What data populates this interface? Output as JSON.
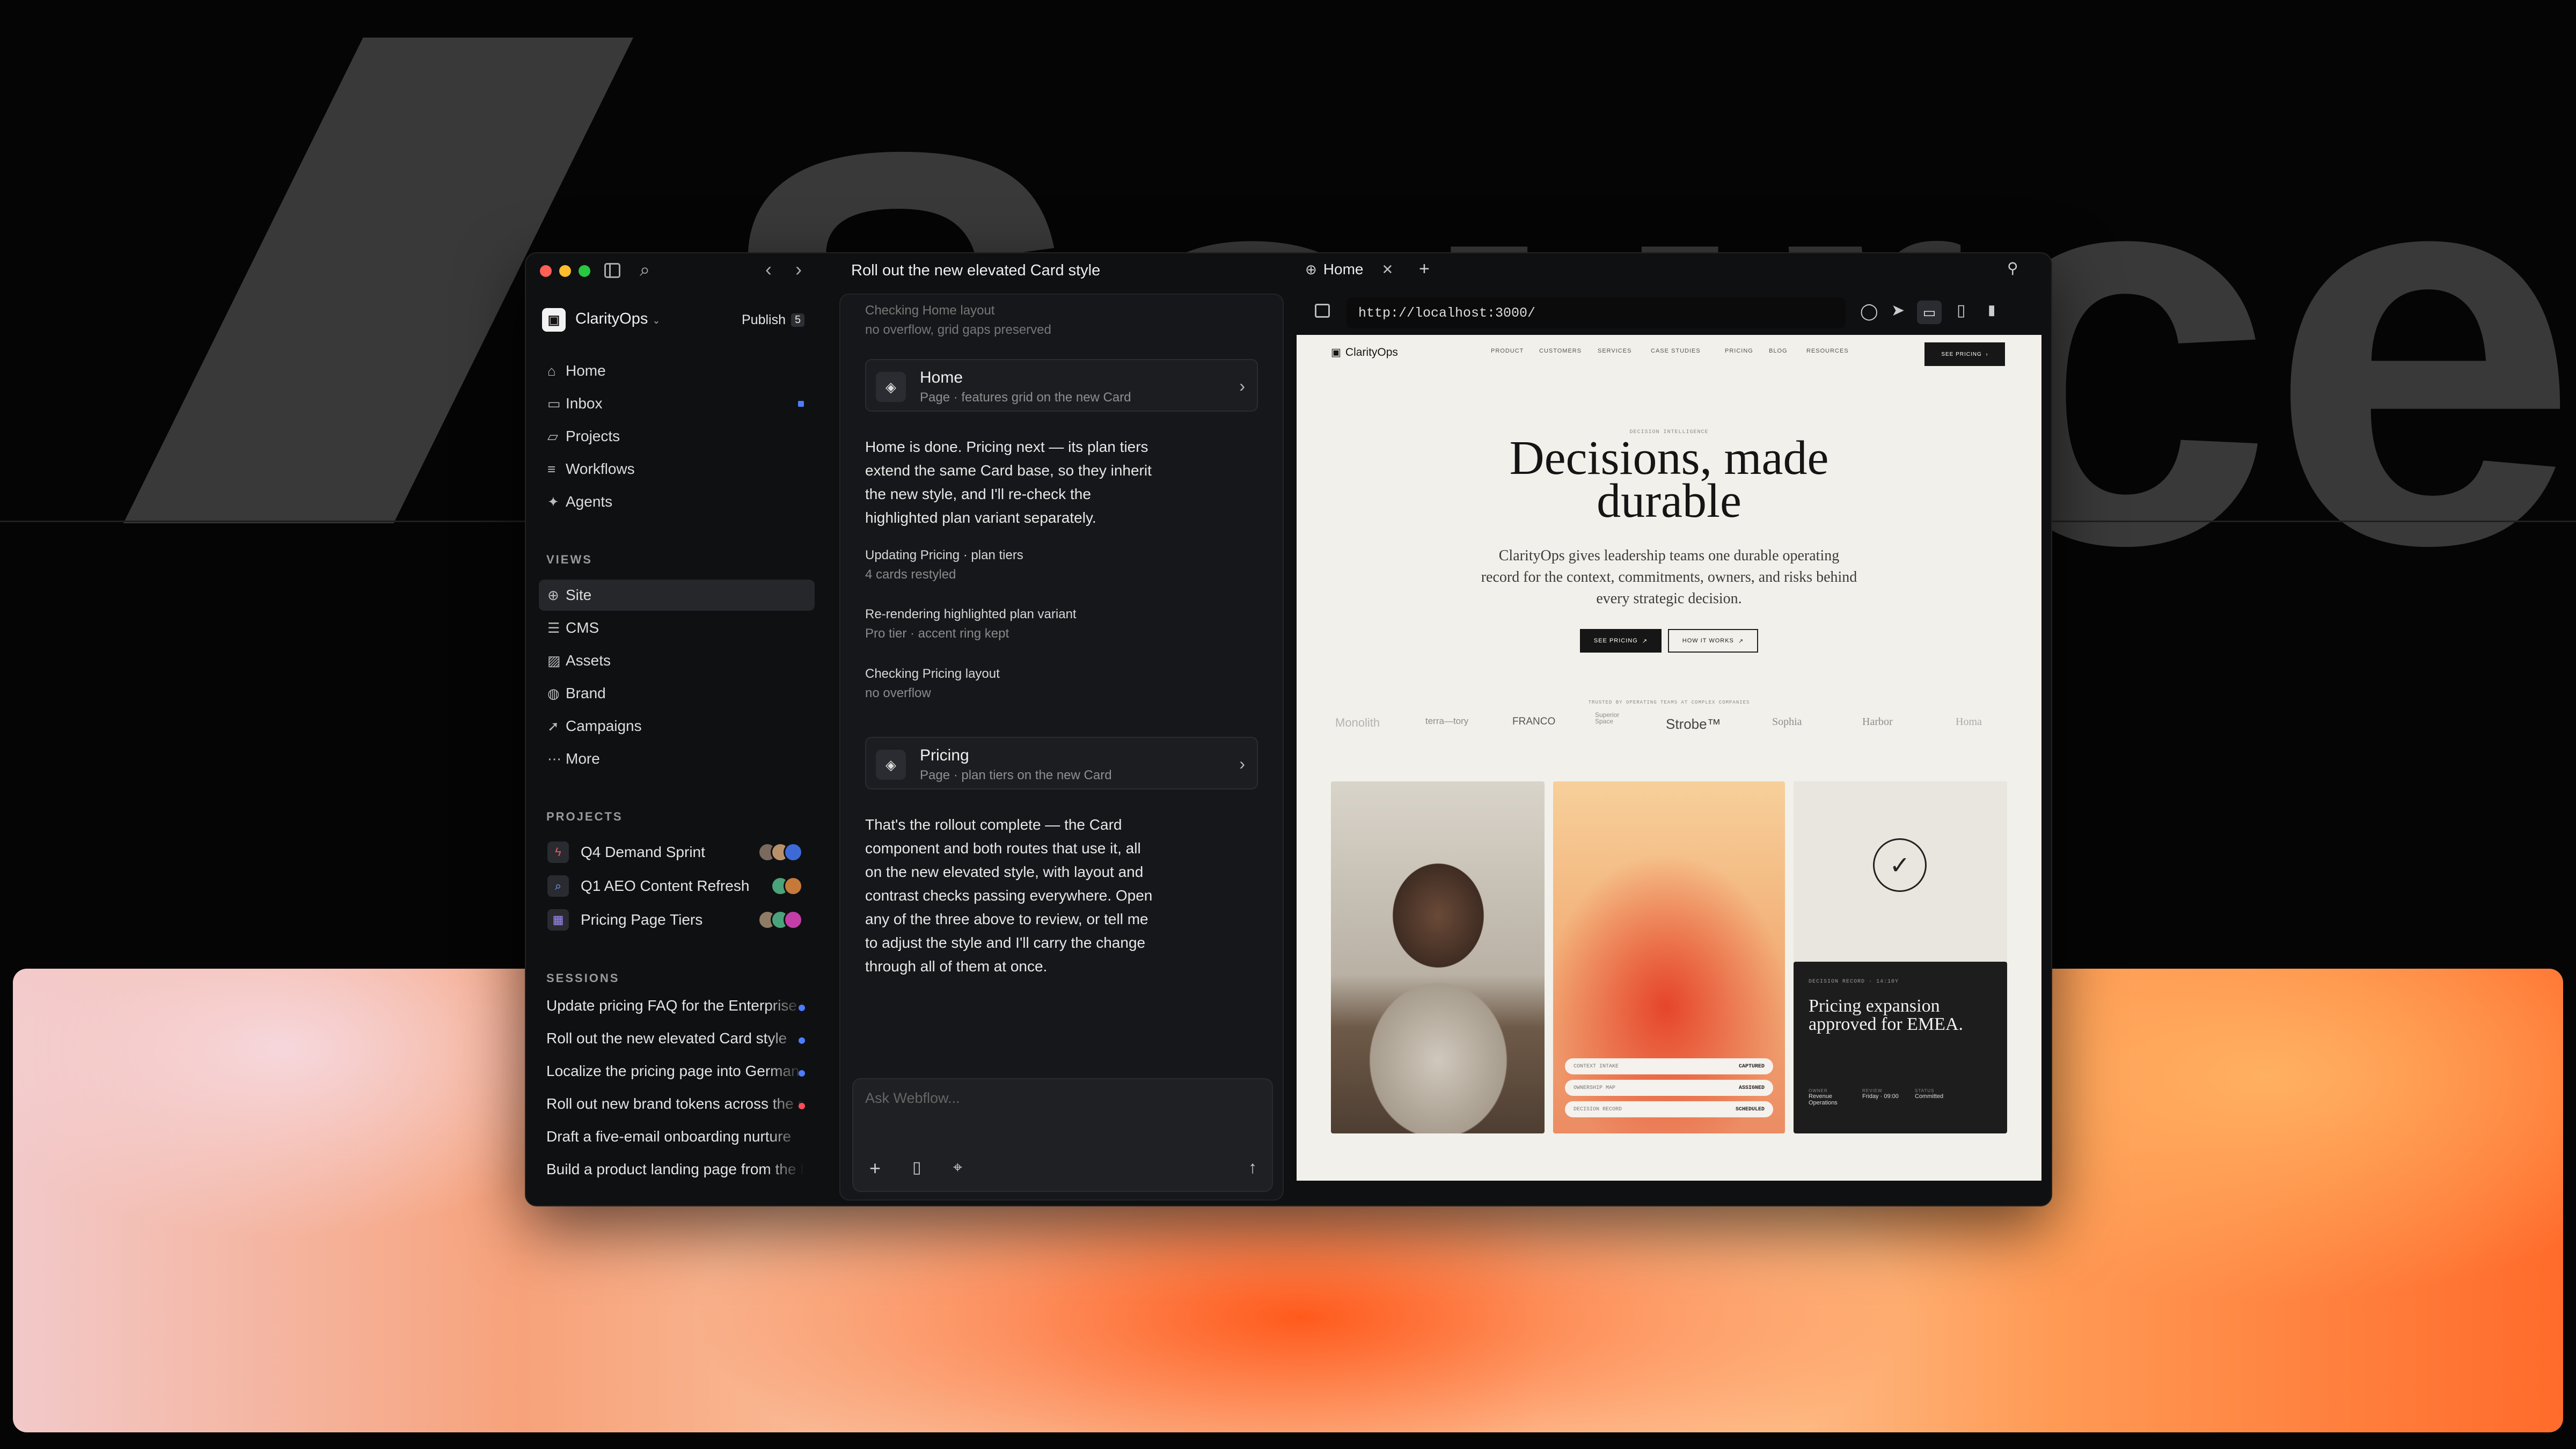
{
  "background": {
    "word": "Source"
  },
  "window": {
    "title": "Roll out the new elevated Card style"
  },
  "sidebar": {
    "workspace": "ClarityOps",
    "publish_label": "Publish",
    "publish_count": "5",
    "nav": [
      {
        "label": "Home",
        "icon": "home-icon"
      },
      {
        "label": "Inbox",
        "icon": "inbox-icon"
      },
      {
        "label": "Projects",
        "icon": "folder-icon"
      },
      {
        "label": "Workflows",
        "icon": "workflow-icon"
      },
      {
        "label": "Agents",
        "icon": "sparkle-icon"
      }
    ],
    "views_header": "VIEWS",
    "views": [
      {
        "label": "Site",
        "icon": "globe-icon"
      },
      {
        "label": "CMS",
        "icon": "database-icon"
      },
      {
        "label": "Assets",
        "icon": "image-icon"
      },
      {
        "label": "Brand",
        "icon": "palette-icon"
      },
      {
        "label": "Campaigns",
        "icon": "rocket-icon"
      },
      {
        "label": "More",
        "icon": "ellipsis-icon"
      }
    ],
    "projects_header": "PROJECTS",
    "projects": [
      {
        "label": "Q4 Demand Sprint",
        "icon": "bolt-icon",
        "color": "#e45b5b"
      },
      {
        "label": "Q1 AEO Content Refresh",
        "icon": "search-icon",
        "color": "#7aa7ff"
      },
      {
        "label": "Pricing Page Tiers",
        "icon": "grid-icon",
        "color": "#a58cff"
      }
    ],
    "sessions_header": "SESSIONS",
    "sessions": [
      {
        "label": "Update pricing FAQ for the Enterprise tier",
        "dot": "#4d7dff"
      },
      {
        "label": "Roll out the new elevated Card style",
        "dot": "#4d7dff"
      },
      {
        "label": "Localize the pricing page into German",
        "dot": "#4d7dff"
      },
      {
        "label": "Roll out new brand tokens across the site",
        "dot": "#ff4d5a"
      },
      {
        "label": "Draft a five-email onboarding nurture",
        "dot": ""
      },
      {
        "label": "Build a product landing page from the brief",
        "dot": ""
      }
    ]
  },
  "chat": {
    "check1_title": "Checking Home layout",
    "check1_sub": "no overflow, grid gaps preserved",
    "card1": {
      "title": "Home",
      "sub": "Page · features grid on the new Card"
    },
    "msg1": "Home is done. Pricing next — its plan tiers extend the same Card base, so they inherit the new style, and I'll re-check the highlighted plan variant separately.",
    "steps": [
      {
        "title": "Updating Pricing · plan tiers",
        "sub": "4 cards restyled"
      },
      {
        "title": "Re-rendering highlighted plan variant",
        "sub": "Pro tier · accent ring kept"
      },
      {
        "title": "Checking Pricing layout",
        "sub": "no overflow"
      }
    ],
    "card2": {
      "title": "Pricing",
      "sub": "Page · plan tiers on the new Card"
    },
    "msg2": "That's the rollout complete — the Card component and both routes that use it, all on the new elevated style, with layout and contrast checks passing everywhere. Open any of the three above to review, or tell me to adjust the style and I'll carry the change through all of them at once.",
    "input_placeholder": "Ask Webflow..."
  },
  "browser": {
    "tab_label": "Home",
    "url": "http://localhost:3000/"
  },
  "site": {
    "brand": "ClarityOps",
    "nav": [
      "PRODUCT",
      "CUSTOMERS",
      "SERVICES",
      "CASE STUDIES",
      "PRICING",
      "BLOG",
      "RESOURCES"
    ],
    "nav_cta": "SEE PRICING",
    "eyebrow": "DECISION INTELLIGENCE",
    "headline_1": "Decisions, made",
    "headline_2": "durable",
    "subhead": "ClarityOps gives leadership teams one durable operating record for the context, commitments, owners, and risks behind every strategic decision.",
    "cta_primary": "SEE PRICING",
    "cta_secondary": "HOW IT WORKS",
    "trusted": "TRUSTED BY OPERATING TEAMS AT COMPLEX COMPANIES",
    "logos": [
      "Monolith",
      "terra—tory",
      "FRANCO",
      "Superior Space",
      "Strobe™",
      "Sophia",
      "Harbor",
      "Homa"
    ],
    "pills": [
      {
        "k": "CONTEXT INTAKE",
        "v": "CAPTURED"
      },
      {
        "k": "OWNERSHIP MAP",
        "v": "ASSIGNED"
      },
      {
        "k": "DECISION RECORD",
        "v": "SCHEDULED"
      }
    ],
    "decision_meta": "DECISION RECORD · 14:10Y",
    "decision_title": "Pricing expansion approved for EMEA.",
    "decision_cols": [
      {
        "k": "OWNER",
        "v": "Revenue Operations"
      },
      {
        "k": "REVIEW",
        "v": "Friday · 09:00"
      },
      {
        "k": "STATUS",
        "v": "Committed"
      }
    ]
  }
}
